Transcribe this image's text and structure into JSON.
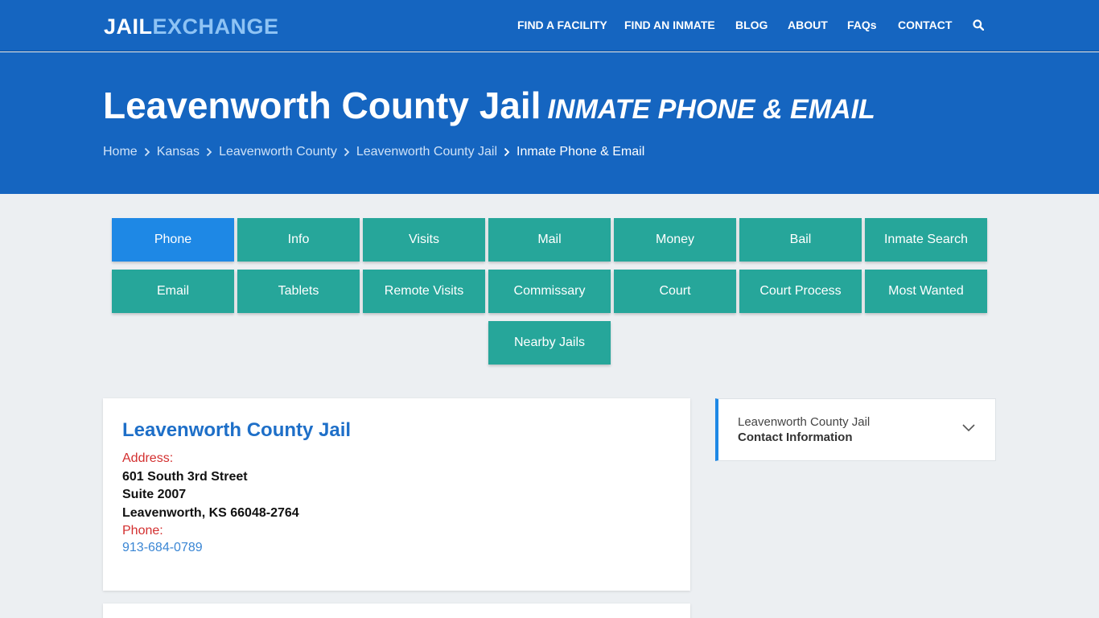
{
  "logo": {
    "part1": "JAIL",
    "part2": "EXCHANGE"
  },
  "nav": {
    "items": [
      "FIND A FACILITY",
      "FIND AN INMATE",
      "BLOG",
      "ABOUT",
      "FAQs",
      "CONTACT"
    ],
    "search_icon": "search-icon"
  },
  "hero": {
    "title": "Leavenworth County Jail",
    "subtitle": "Inmate Phone & Email",
    "breadcrumb": [
      "Home",
      "Kansas",
      "Leavenworth County",
      "Leavenworth County Jail",
      "Inmate Phone & Email"
    ]
  },
  "tabs": {
    "row1": [
      "Phone",
      "Info",
      "Visits",
      "Mail",
      "Money",
      "Bail",
      "Inmate Search"
    ],
    "row2": [
      "Email",
      "Tablets",
      "Remote Visits",
      "Commissary",
      "Court",
      "Court Process",
      "Most Wanted"
    ],
    "row3": [
      "Nearby Jails"
    ],
    "active": "Phone"
  },
  "facility": {
    "name": "Leavenworth County Jail",
    "address_label": "Address:",
    "address_line1": "601 South 3rd Street",
    "address_line2": "Suite 2007",
    "address_line3": "Leavenworth, KS 66048-2764",
    "phone_label": "Phone:",
    "phone": "913-684-0789"
  },
  "sidebar": {
    "line1": "Leavenworth County Jail",
    "line2": "Contact Information"
  },
  "colors": {
    "brand_blue": "#1565c0",
    "tab_teal": "#26a69a",
    "tab_active": "#1e88e5",
    "label_red": "#d32f2f",
    "link_blue": "#3a86d4"
  }
}
